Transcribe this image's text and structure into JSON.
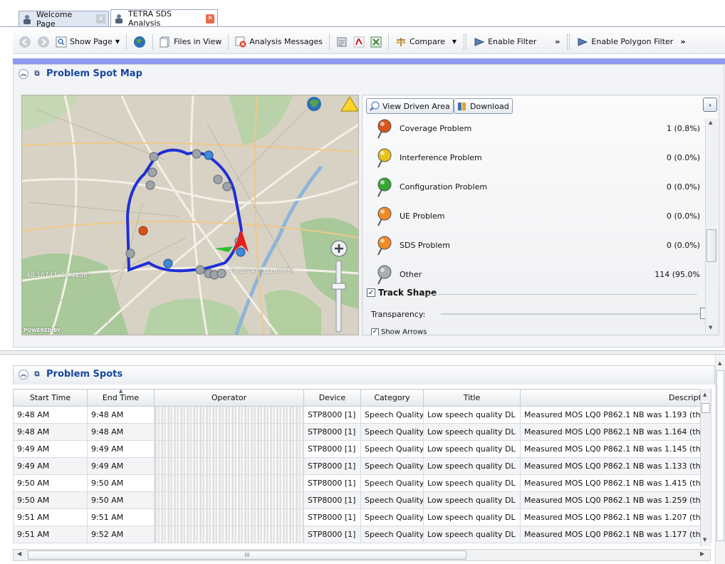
{
  "tabs": [
    {
      "label": "Welcome Page",
      "active": false
    },
    {
      "label": "TETRA SDS Analysis",
      "active": true
    }
  ],
  "toolbar": {
    "show_page": "Show Page",
    "files_in_view": "Files in View",
    "analysis_messages": "Analysis Messages",
    "compare": "Compare",
    "enable_filter": "Enable Filter",
    "more": "»",
    "enable_polygon_filter": "Enable Polygon Filter",
    "more2": "»"
  },
  "problem_spot_map": {
    "title": "Problem Spot Map",
    "coord_left": "48.10747, 11.4258\"",
    "coord_right": "48.1074?\", 11.60?6\"",
    "powered_by": "POWERED BY",
    "view_driven_area": "View Driven Area",
    "download": "Download",
    "legend": [
      {
        "label": "Coverage Problem",
        "value": "1 (0.8%)",
        "color": "#d9541c"
      },
      {
        "label": "Interference Problem",
        "value": "0 (0.0%)",
        "color": "#e6c21a"
      },
      {
        "label": "Configuration Problem",
        "value": "0 (0.0%)",
        "color": "#35a831"
      },
      {
        "label": "UE Problem",
        "value": "0 (0.0%)",
        "color": "#f08a24"
      },
      {
        "label": "SDS Problem",
        "value": "0 (0.0%)",
        "color": "#f08a24"
      },
      {
        "label": "Other",
        "value": "114 (95.0%",
        "color": "#a7adb3"
      }
    ],
    "track_shape": "Track Shape",
    "transparency": "Transparency:",
    "show_arrows": "Show Arrows"
  },
  "problem_spots": {
    "title": "Problem Spots",
    "columns": [
      "Start Time",
      "End Time",
      "Operator",
      "Device",
      "Category",
      "Title",
      "Descriptic"
    ],
    "rows": [
      [
        "9:48 AM",
        "9:48 AM",
        "",
        "STP8000 [1]",
        "Speech Quality",
        "Low speech quality DL",
        "Measured MOS LQ0 P862.1 NB was 1.193 (th"
      ],
      [
        "9:48 AM",
        "9:48 AM",
        "",
        "STP8000 [1]",
        "Speech Quality",
        "Low speech quality DL",
        "Measured MOS LQ0 P862.1 NB was 1.164 (th"
      ],
      [
        "9:49 AM",
        "9:49 AM",
        "",
        "STP8000 [1]",
        "Speech Quality",
        "Low speech quality DL",
        "Measured MOS LQ0 P862.1 NB was 1.145 (th"
      ],
      [
        "9:49 AM",
        "9:49 AM",
        "",
        "STP8000 [1]",
        "Speech Quality",
        "Low speech quality DL",
        "Measured MOS LQ0 P862.1 NB was 1.133 (th"
      ],
      [
        "9:50 AM",
        "9:50 AM",
        "",
        "STP8000 [1]",
        "Speech Quality",
        "Low speech quality DL",
        "Measured MOS LQ0 P862.1 NB was 1.415 (th"
      ],
      [
        "9:50 AM",
        "9:50 AM",
        "",
        "STP8000 [1]",
        "Speech Quality",
        "Low speech quality DL",
        "Measured MOS LQ0 P862.1 NB was 1.259 (th"
      ],
      [
        "9:51 AM",
        "9:51 AM",
        "",
        "STP8000 [1]",
        "Speech Quality",
        "Low speech quality DL",
        "Measured MOS LQ0 P862.1 NB was 1.207 (th"
      ],
      [
        "9:51 AM",
        "9:52 AM",
        "",
        "STP8000 [1]",
        "Speech Quality",
        "Low speech quality DL",
        "Measured MOS LQ0 P862.1 NB was 1.177 (th"
      ]
    ],
    "hscroll_grip": "III"
  }
}
